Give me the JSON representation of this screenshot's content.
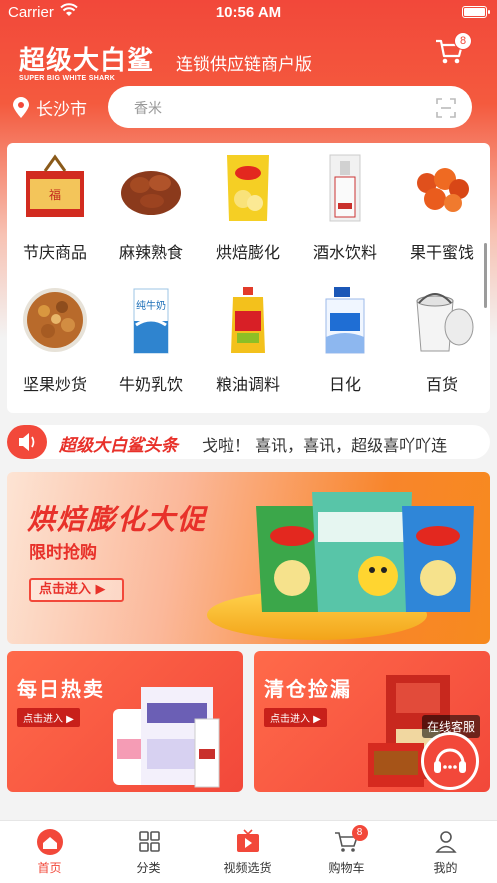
{
  "status": {
    "carrier": "Carrier",
    "time": "10:56 AM"
  },
  "header": {
    "title": "超级大白鲨",
    "subtitle_en": "SUPER BIG WHITE SHARK",
    "slogan": "连锁供应链商户版",
    "cart_badge": "8"
  },
  "location": {
    "city": "长沙市"
  },
  "search": {
    "placeholder": "香米"
  },
  "categories": [
    {
      "label": "节庆商品",
      "icon": "gift-box-icon"
    },
    {
      "label": "麻辣熟食",
      "icon": "braised-meat-icon"
    },
    {
      "label": "烘焙膨化",
      "icon": "chips-bag-icon"
    },
    {
      "label": "酒水饮料",
      "icon": "liquor-bottle-icon"
    },
    {
      "label": "果干蜜饯",
      "icon": "dried-fruit-icon"
    },
    {
      "label": "坚果炒货",
      "icon": "nuts-icon"
    },
    {
      "label": "牛奶乳饮",
      "icon": "milk-carton-icon"
    },
    {
      "label": "粮油调料",
      "icon": "oil-bottle-icon"
    },
    {
      "label": "日化",
      "icon": "detergent-icon"
    },
    {
      "label": "百货",
      "icon": "bucket-icon"
    }
  ],
  "news": {
    "headline": "超级大白鲨头条",
    "ticker": "戈啦！   喜讯，喜讯，超级喜吖吖连"
  },
  "banner": {
    "title": "烘焙膨化大促",
    "subtitle": "限时抢购",
    "button": "点击进入 ▶"
  },
  "promos": [
    {
      "title": "每日热卖",
      "button": "点击进入 ▶"
    },
    {
      "title": "清仓捡漏",
      "button": "点击进入 ▶"
    }
  ],
  "service": {
    "label": "在线客服"
  },
  "tabs": [
    {
      "label": "首页",
      "icon": "home-icon",
      "active": true
    },
    {
      "label": "分类",
      "icon": "grid-icon",
      "active": false
    },
    {
      "label": "视频选货",
      "icon": "video-icon",
      "active": false
    },
    {
      "label": "购物车",
      "icon": "cart-icon",
      "active": false,
      "badge": "8"
    },
    {
      "label": "我的",
      "icon": "person-icon",
      "active": false
    }
  ],
  "colors": {
    "brand_red": "#f2483a",
    "orange": "#f78a1e"
  }
}
